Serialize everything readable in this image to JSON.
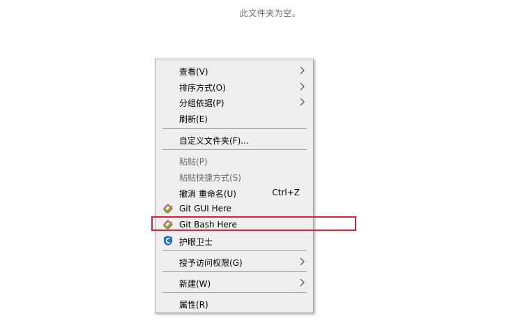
{
  "folder": {
    "empty_message": "此文件夹为空。"
  },
  "context_menu": {
    "view": "查看(V)",
    "sort_by": "排序方式(O)",
    "group_by": "分组依据(P)",
    "refresh": "刷新(E)",
    "customize_folder": "自定义文件夹(F)...",
    "paste": "粘贴(P)",
    "paste_shortcut": "粘贴快捷方式(S)",
    "undo_rename": "撤消 重命名(U)",
    "undo_shortcut": "Ctrl+Z",
    "git_gui": "Git GUI Here",
    "git_bash": "Git Bash Here",
    "eye_guard": "护眼卫士",
    "give_access": "授予访问权限(G)",
    "new": "新建(W)",
    "properties": "属性(R)"
  },
  "icons": {
    "submenu": "chevron-right-icon",
    "git": "git-icon",
    "eye_guard": "shield-icon"
  },
  "colors": {
    "highlight": "#d9232a",
    "git_diamond": "#e5533d",
    "git_check": "#6db33f",
    "shield": "#1f6fd1",
    "disabled_text": "#6d6d6d"
  }
}
